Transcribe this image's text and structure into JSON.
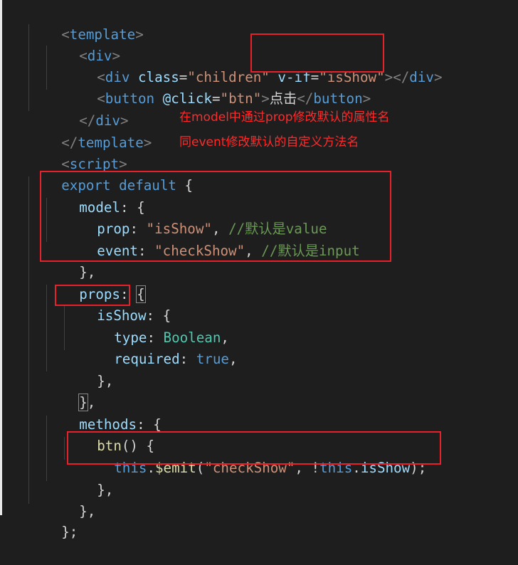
{
  "code": {
    "l1": {
      "a": "<",
      "b": "template",
      "c": ">"
    },
    "l2": {
      "a": "<",
      "b": "div",
      "c": ">"
    },
    "l3": {
      "a": "<",
      "b": "div",
      "c": " ",
      "d": "class",
      "e": "=",
      "f": "\"children\"",
      "g": " ",
      "h": "v-if",
      "i": "=",
      "j": "\"isShow\"",
      "k": ">",
      "l": "</",
      "m": "div",
      "n": ">"
    },
    "l4": {
      "a": "<",
      "b": "button",
      "c": " ",
      "d": "@click",
      "e": "=",
      "f": "\"btn\"",
      "g": ">",
      "h": "点击",
      "i": "</",
      "j": "button",
      "k": ">"
    },
    "l5": {
      "a": "</",
      "b": "div",
      "c": ">"
    },
    "l6": {
      "a": "</",
      "b": "template",
      "c": ">"
    },
    "l7": {
      "a": "<",
      "b": "script",
      "c": ">"
    },
    "l8": {
      "a": "export",
      "b": " ",
      "c": "default",
      "d": " {"
    },
    "l9": {
      "a": "model",
      "b": ": {"
    },
    "l10": {
      "a": "prop",
      "b": ": ",
      "c": "\"isShow\"",
      "d": ", ",
      "e": "//默认是value"
    },
    "l11": {
      "a": "event",
      "b": ": ",
      "c": "\"checkShow\"",
      "d": ", ",
      "e": "//默认是input"
    },
    "l12": {
      "a": "},"
    },
    "l13": {
      "a": "props",
      "b": ": ",
      "c": "{"
    },
    "l14": {
      "a": "isShow",
      "b": ": {"
    },
    "l15": {
      "a": "type",
      "b": ": ",
      "c": "Boolean",
      "d": ","
    },
    "l16": {
      "a": "required",
      "b": ": ",
      "c": "true",
      "d": ","
    },
    "l17": {
      "a": "},"
    },
    "l18": {
      "a": "}",
      "b": ","
    },
    "l19": {
      "a": "methods",
      "b": ": {"
    },
    "l20": {
      "a": "btn",
      "b": "() {"
    },
    "l21": {
      "a": "this",
      "b": ".",
      "c": "$emit",
      "d": "(",
      "e": "\"checkShow\"",
      "f": ", !",
      "g": "this",
      "h": ".",
      "i": "isShow",
      "j": ");"
    },
    "l22": {
      "a": "},"
    },
    "l23": {
      "a": "},"
    },
    "l24": {
      "a": "};"
    }
  },
  "annotations": {
    "note1": "在model中通过prop修改默认的属性名",
    "note2": "同event修改默认的自定义方法名"
  },
  "colors": {
    "background": "#1e1e1e",
    "highlight_box": "#e8202a",
    "annotation_text": "#ff2a2a"
  }
}
